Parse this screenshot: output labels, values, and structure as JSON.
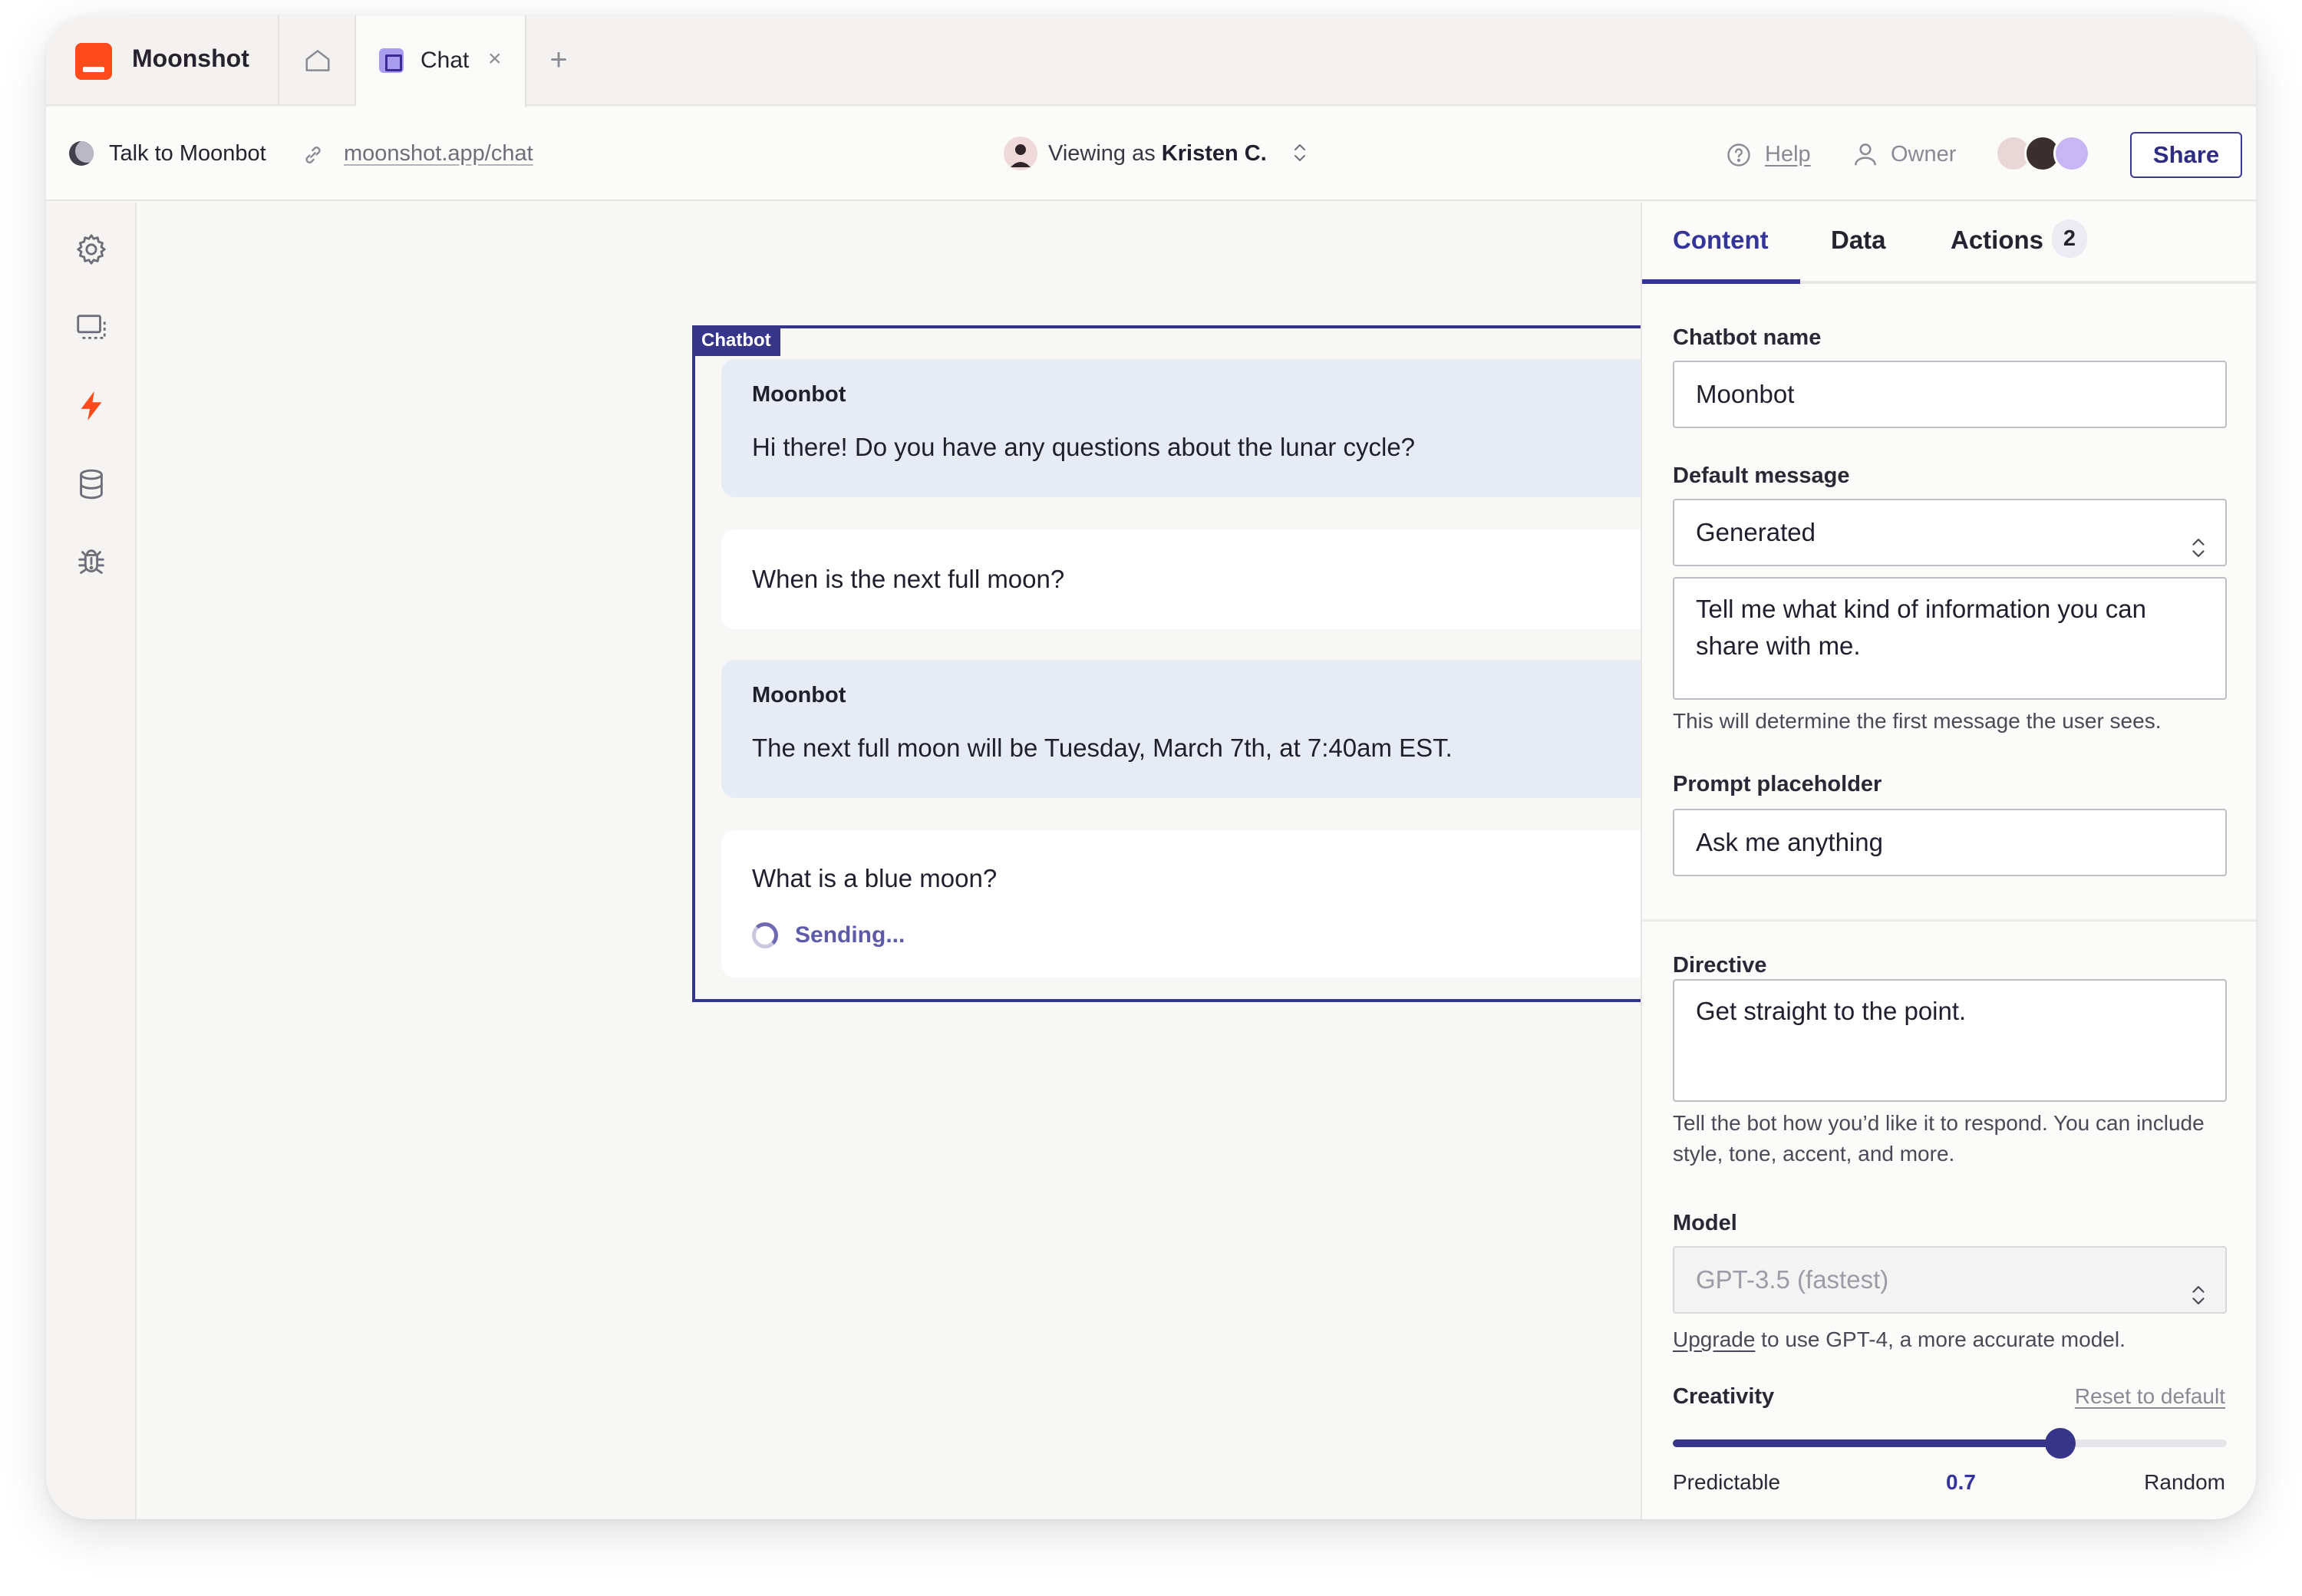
{
  "tabbar": {
    "app_name": "Moonshot",
    "tabs": [
      {
        "label": "Chat",
        "close": "×"
      }
    ],
    "add_tab": "+"
  },
  "toolbar": {
    "project_name": "Talk to Moonbot",
    "project_url": "moonshot.app/chat",
    "viewing_prefix": "Viewing as",
    "viewing_user": "Kristen C.",
    "help": "Help",
    "owner": "Owner",
    "share": "Share"
  },
  "sidebar": {
    "icons": [
      "settings-icon",
      "display-icon",
      "lightning-icon",
      "database-icon",
      "bug-icon"
    ],
    "active": "lightning-icon",
    "accent": "#ff4a1c"
  },
  "chatbot": {
    "tag": "Chatbot",
    "messages": [
      {
        "role": "bot",
        "sender": "Moonbot",
        "text": "Hi there! Do you have any questions about the lunar cycle?"
      },
      {
        "role": "user",
        "text": "When is the next full moon?"
      },
      {
        "role": "bot",
        "sender": "Moonbot",
        "text": "The next full moon will be Tuesday, March 7th, at 7:40am EST."
      },
      {
        "role": "user",
        "text": "What is a blue moon?",
        "status": "Sending..."
      }
    ]
  },
  "panel": {
    "tabs": [
      {
        "label": "Content",
        "active": true
      },
      {
        "label": "Data"
      },
      {
        "label": "Actions",
        "badge": "2"
      }
    ],
    "chatbot_name": {
      "label": "Chatbot name",
      "value": "Moonbot"
    },
    "default_message": {
      "label": "Default message",
      "selected": "Generated",
      "text": "Tell me what kind of information you can share with me.",
      "hint": "This will determine the first message the user sees."
    },
    "prompt_placeholder": {
      "label": "Prompt placeholder",
      "value": "Ask me anything"
    },
    "directive": {
      "label": "Directive",
      "value": "Get straight to the point.",
      "hint": "Tell the bot how you’d like it to respond. You can include style, tone, accent, and more."
    },
    "model": {
      "label": "Model",
      "selected": "GPT-3.5 (fastest)",
      "upgrade_link": "Upgrade",
      "hint_rest": " to use GPT-4, a more accurate model."
    },
    "creativity": {
      "label": "Creativity",
      "reset": "Reset to default",
      "min_label": "Predictable",
      "max_label": "Random",
      "value": "0.7",
      "fraction": 0.7
    }
  },
  "colors": {
    "accent": "#36358a",
    "brand": "#ff4a1c",
    "bot_bubble": "#e7ebf4"
  }
}
